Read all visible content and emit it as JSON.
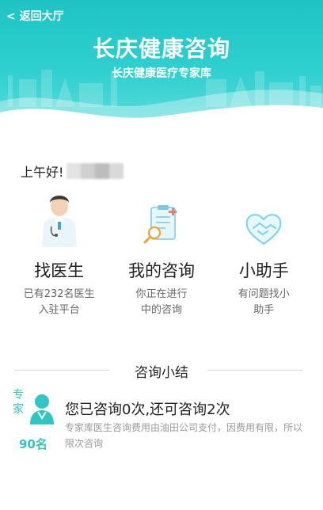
{
  "header": {
    "back_label": "< 返回大厅",
    "title": "长庆健康咨询",
    "subtitle": "长庆健康医疗专家库"
  },
  "greeting": {
    "text": "上午好!"
  },
  "features": [
    {
      "name": "找医生",
      "desc_line1": "已有232名医生",
      "desc_line2": "入驻平台",
      "icon": "doctor-icon"
    },
    {
      "name": "我的咨询",
      "desc_line1": "你正在进行",
      "desc_line2": "中的咨询",
      "icon": "clipboard-search-icon"
    },
    {
      "name": "小助手",
      "desc_line1": "有问题找小",
      "desc_line2": "助手",
      "icon": "heart-handshake-icon"
    }
  ],
  "summary": {
    "section_title": "咨询小结",
    "expert_label": "专家",
    "expert_count": "90名",
    "main_text": "您已咨询0次,还可咨询2次",
    "note_text": "专家库医生咨询费用由油田公司支付，因费用有限，所以限次咨询"
  },
  "colors": {
    "accent": "#2fc6c3",
    "header_top": "#1fc3c4",
    "header_bottom": "#5fdcdc"
  }
}
